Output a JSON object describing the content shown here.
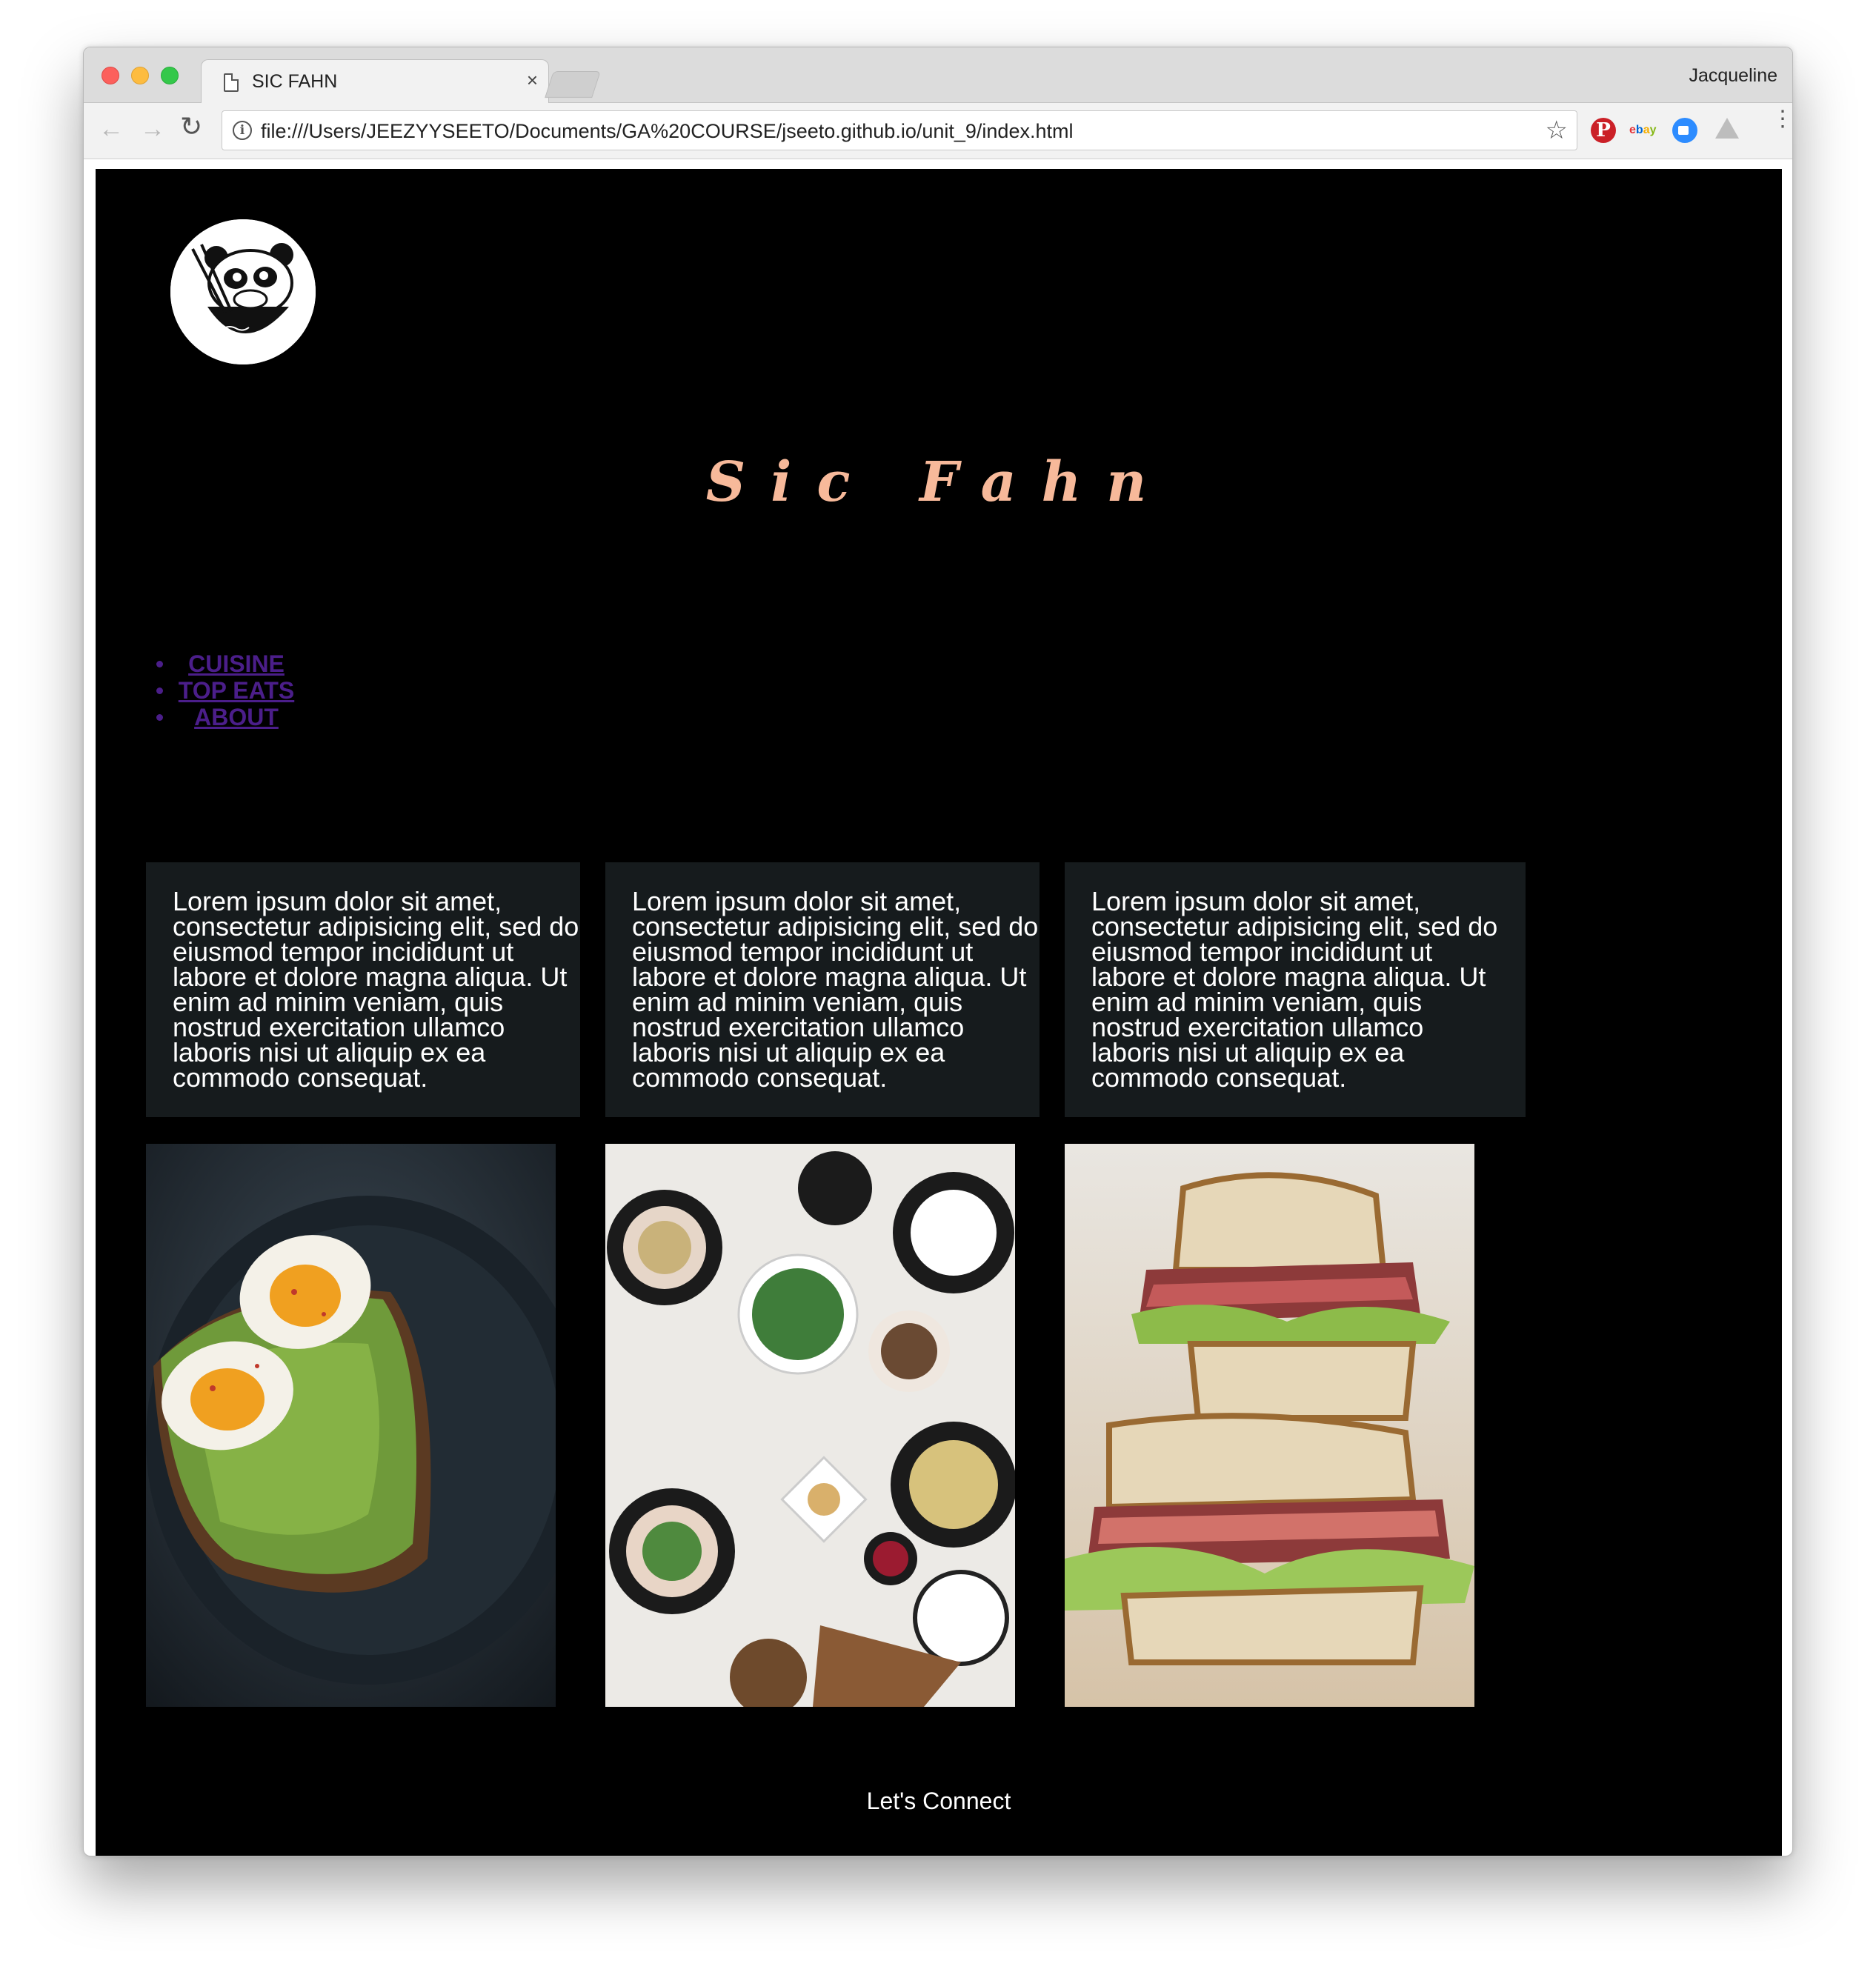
{
  "browser": {
    "tab_title": "SIC FAHN",
    "tab_close": "×",
    "profile_name": "Jacqueline",
    "url": "file:///Users/JEEZYYSEETO/Documents/GA%20COURSE/jseeto.github.io/unit_9/index.html",
    "back_icon": "←",
    "forward_icon": "→",
    "reload_icon": "↻",
    "info_icon": "i",
    "star_icon": "☆",
    "menu_icon": "⋮",
    "extensions": [
      "pinterest-icon",
      "ebay-icon",
      "zoom-icon",
      "google-drive-icon"
    ]
  },
  "page": {
    "title": "Sic Fahn",
    "nav": [
      "CUISINE",
      "TOP EATS",
      "ABOUT"
    ],
    "cards": [
      "Lorem ipsum dolor sit amet, consectetur adipisicing elit, sed do eiusmod tempor incididunt ut labore et dolore magna aliqua. Ut enim ad minim veniam, quis nostrud exercitation ullamco laboris nisi ut aliquip ex ea commodo consequat.",
      "Lorem ipsum dolor sit amet, consectetur adipisicing elit, sed do eiusmod tempor incididunt ut labore et dolore magna aliqua. Ut enim ad minim veniam, quis nostrud exercitation ullamco laboris nisi ut aliquip ex ea commodo consequat.",
      "Lorem ipsum dolor sit amet, consectetur adipisicing elit, sed do eiusmod tempor incididunt ut labore et dolore magna aliqua. Ut enim ad minim veniam, quis nostrud exercitation ullamco laboris nisi ut aliquip ex ea commodo consequat."
    ],
    "photos": [
      "avocado-toast-egg-photo",
      "dinner-table-overhead-photo",
      "steak-sandwich-photo"
    ],
    "footer": "Let's Connect"
  },
  "colors": {
    "page_background": "#000000",
    "title_color": "#f7b99a",
    "nav_link": "#4b1e8a",
    "card_background": "#161b1d",
    "text_color": "#ffffff"
  }
}
